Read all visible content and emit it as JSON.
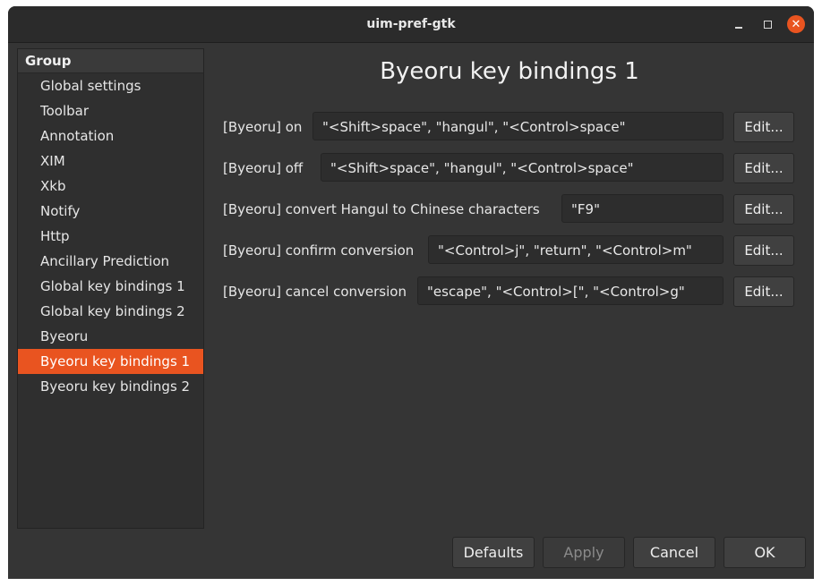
{
  "window": {
    "title": "uim-pref-gtk"
  },
  "sidebar": {
    "header": "Group",
    "items": [
      {
        "label": "Global settings"
      },
      {
        "label": "Toolbar"
      },
      {
        "label": "Annotation"
      },
      {
        "label": "XIM"
      },
      {
        "label": "Xkb"
      },
      {
        "label": "Notify"
      },
      {
        "label": "Http"
      },
      {
        "label": "Ancillary Prediction"
      },
      {
        "label": "Global key bindings 1"
      },
      {
        "label": "Global key bindings 2"
      },
      {
        "label": "Byeoru"
      },
      {
        "label": "Byeoru key bindings 1",
        "selected": true
      },
      {
        "label": "Byeoru key bindings 2"
      }
    ]
  },
  "main": {
    "heading": "Byeoru key bindings 1",
    "rows": [
      {
        "label": "[Byeoru] on",
        "value": "\"<Shift>space\", \"hangul\", \"<Control>space\"",
        "edit": "Edit..."
      },
      {
        "label": "[Byeoru] off",
        "value": "\"<Shift>space\", \"hangul\", \"<Control>space\"",
        "edit": "Edit..."
      },
      {
        "label": "[Byeoru] convert Hangul to Chinese characters",
        "value": "\"F9\"",
        "edit": "Edit..."
      },
      {
        "label": "[Byeoru] confirm conversion",
        "value": "\"<Control>j\", \"return\", \"<Control>m\"",
        "edit": "Edit..."
      },
      {
        "label": "[Byeoru] cancel conversion",
        "value": "\"escape\", \"<Control>[\", \"<Control>g\"",
        "edit": "Edit..."
      }
    ]
  },
  "footer": {
    "defaults": "Defaults",
    "apply": "Apply",
    "cancel": "Cancel",
    "ok": "OK"
  },
  "colors": {
    "accent": "#e95420",
    "background": "#353535",
    "sidebar": "#2f2f2f"
  },
  "icons": {
    "minimize": "minimize-icon",
    "maximize": "maximize-icon",
    "close": "close-icon"
  }
}
